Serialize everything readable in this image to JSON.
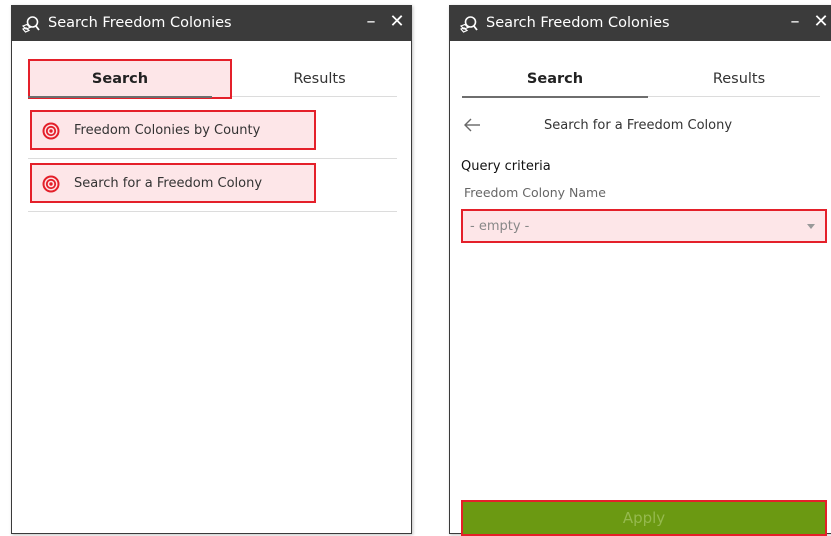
{
  "colors": {
    "titlebar_bg": "#3b3b3b",
    "highlight_border": "#e4202a",
    "highlight_fill": "#fde6e8",
    "target_icon": "#e4202a",
    "apply_button": "#6b9912"
  },
  "left_panel": {
    "title": "Search Freedom Colonies",
    "title_icon": "search-layer-icon",
    "minimize_label": "–",
    "close_label": "✕",
    "tabs": [
      {
        "label": "Search",
        "active": true
      },
      {
        "label": "Results",
        "active": false
      }
    ],
    "items": [
      {
        "label": "Freedom Colonies by County",
        "icon": "target-icon"
      },
      {
        "label": "Search for a Freedom Colony",
        "icon": "target-icon"
      }
    ]
  },
  "right_panel": {
    "title": "Search Freedom Colonies",
    "title_icon": "search-layer-icon",
    "minimize_label": "–",
    "close_label": "✕",
    "tabs": [
      {
        "label": "Search",
        "active": true
      },
      {
        "label": "Results",
        "active": false
      }
    ],
    "back_icon": "back-arrow-icon",
    "sub_title": "Search for a Freedom Colony",
    "query_label": "Query criteria",
    "field_label": "Freedom Colony Name",
    "field_value": "- empty -",
    "apply_label": "Apply"
  }
}
